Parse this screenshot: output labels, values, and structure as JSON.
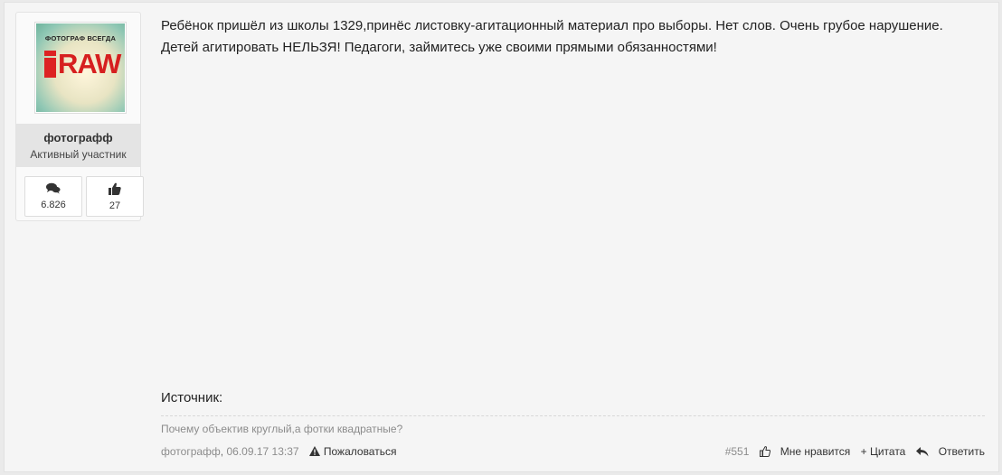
{
  "user": {
    "avatar_top_text": "ФОТОГРАФ ВСЕГДА",
    "avatar_logo_text": "RAW",
    "name": "фотографф",
    "title": "Активный участник",
    "stats": {
      "messages": "6.826",
      "likes": "27"
    }
  },
  "post": {
    "message_line1": "Ребёнок пришёл из школы 1329,принёс листовку-агитационный материал про выборы. Нет слов. Очень грубое нарушение.",
    "message_line2": "Детей агитировать НЕЛЬЗЯ! Педагоги, займитесь уже своими прямыми обязанностями!",
    "source_label": "Источник:",
    "signature": "Почему объектив круглый,а фотки квадратные?"
  },
  "footer": {
    "author": "фотографф",
    "date": "06.09.17 13:37",
    "report_label": "Пожаловаться",
    "post_number": "#551",
    "like_label": "Мне нравится",
    "quote_label": "+ Цитата",
    "reply_label": "Ответить"
  },
  "icons": {
    "messages": "speech-bubbles-icon",
    "likes": "thumbs-up-icon",
    "report": "warning-icon",
    "like": "thumbs-up-outline-icon",
    "reply": "reply-icon"
  },
  "colors": {
    "avatar_logo": "#d61f1f",
    "background": "#eaeaea",
    "post_bg": "#f5f5f5"
  }
}
